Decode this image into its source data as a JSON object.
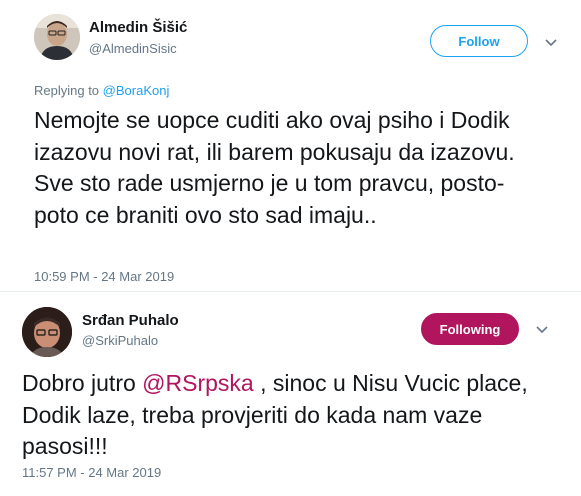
{
  "tweets": [
    {
      "name": "Almedin Šišić",
      "handle": "@AlmedinSisic",
      "button_label": "Follow",
      "reply_prefix": "Replying to ",
      "reply_mention": "@BoraKonj",
      "body": "Nemojte se uopce cuditi ako ovaj psiho i Dodik izazovu novi rat, ili barem pokusaju da izazovu. Sve sto rade usmjerno je u tom pravcu, posto-poto ce braniti ovo sto sad imaju..",
      "timestamp": "10:59 PM - 24 Mar 2019"
    },
    {
      "name": "Srđan Puhalo",
      "handle": "@SrkiPuhalo",
      "button_label": "Following",
      "body_before": "Dobro jutro ",
      "body_mention": "@RSrpska",
      "body_after": " , sinoc u Nisu Vucic place, Dodik laze, treba provjeriti do kada nam vaze pasosi!!!",
      "timestamp": "11:57 PM - 24 Mar 2019"
    }
  ],
  "colors": {
    "link_blue": "#1da1f2",
    "following_magenta": "#b0155e",
    "secondary_text": "#657786"
  },
  "icons": [
    "chevron-down-icon"
  ]
}
